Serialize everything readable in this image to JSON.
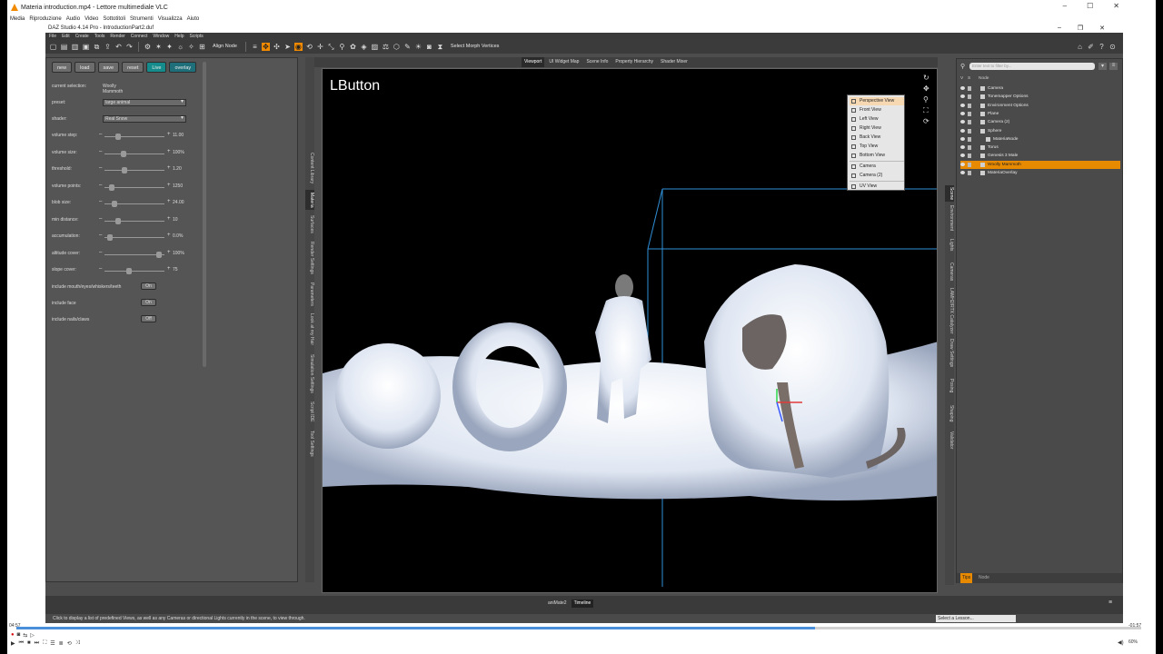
{
  "vlc": {
    "title": "Materia introduction.mp4 - Lettore multimediale VLC",
    "menu": [
      "Media",
      "Riproduzione",
      "Audio",
      "Video",
      "Sottotitoli",
      "Strumenti",
      "Visualizza",
      "Aiuto"
    ],
    "time_elapsed": "04:57",
    "time_total": "-01:57",
    "progress": 0.71,
    "volume": "60%"
  },
  "daz": {
    "title": "DAZ Studio 4.14 Pro - IntroductionPart2.duf",
    "menu": [
      "File",
      "Edit",
      "Create",
      "Tools",
      "Render",
      "Connect",
      "Window",
      "Help",
      "Scripts"
    ],
    "toolbar": {
      "align_node": "Align Node",
      "select_morph": "Select Morph Vertices"
    },
    "status_text": "Click to display a list of predefined Views, as well as any Cameras or directional Lights currently in the scene, to view through.",
    "timeline_tabs": [
      "aniMate2",
      "Timeline"
    ],
    "lesson_select": "Select a Lesson...",
    "tips_tabs": [
      "Tips",
      "Node"
    ]
  },
  "materia": {
    "buttons": [
      "new",
      "load",
      "save",
      "reset",
      "Live",
      "overlay"
    ],
    "current_selection_label": "current selection:",
    "current_selection_value": "Woolly Mammoth",
    "preset_label": "preset:",
    "preset_value": "large animal",
    "shader_label": "shader:",
    "shader_value": "Real Snow",
    "sliders": [
      {
        "label": "volume step:",
        "value": "11.00",
        "pos": 0.2
      },
      {
        "label": "volume size:",
        "value": "100%",
        "pos": 0.3
      },
      {
        "label": "threshold:",
        "value": "1.20",
        "pos": 0.32
      },
      {
        "label": "volume points:",
        "value": "1250",
        "pos": 0.08
      },
      {
        "label": "blob size:",
        "value": "24.00",
        "pos": 0.14
      },
      {
        "label": "min distance:",
        "value": "10",
        "pos": 0.2
      },
      {
        "label": "accumulation:",
        "value": "0.0%",
        "pos": 0.05
      },
      {
        "label": "altitude cover:",
        "value": "100%",
        "pos": 0.95
      },
      {
        "label": "slope cover:",
        "value": "75",
        "pos": 0.4
      }
    ],
    "toggles": [
      {
        "label": "include mouth/eyes/whiskers/teeth",
        "value": "On"
      },
      {
        "label": "include face",
        "value": "On"
      },
      {
        "label": "include nails/claws",
        "value": "Off"
      }
    ]
  },
  "left_tabs": [
    "Content Library",
    "Materia",
    "Surfaces",
    "Render Settings",
    "Parameters",
    "Look at my Hair",
    "Simulation Settings",
    "Script IDE",
    "Tool Settings"
  ],
  "viewport_tabs": [
    "Viewport",
    "UI Widget Map",
    "Scene Info",
    "Property Hierarchy",
    "Shader Mixer"
  ],
  "viewport_label": "LButton",
  "view_menu": [
    "Perspective View",
    "Front View",
    "Left View",
    "Right View",
    "Back View",
    "Top View",
    "Bottom View",
    "Camera",
    "Camera (2)",
    "UV View"
  ],
  "right_tabs": [
    "Scene",
    "Environment",
    "Lights",
    "Cameras",
    "LAMH2/RTX Catalyzer",
    "Draw Settings",
    "Posing",
    "Shaping",
    "Validator"
  ],
  "scene": {
    "search_placeholder": "Enter text to filter by...",
    "header": "Node",
    "nodes": [
      {
        "name": "Camera",
        "indent": 0
      },
      {
        "name": "Tonemapper Options",
        "indent": 0
      },
      {
        "name": "Environment Options",
        "indent": 0
      },
      {
        "name": "Plane",
        "indent": 0
      },
      {
        "name": "Camera (2)",
        "indent": 0
      },
      {
        "name": "Sphere",
        "indent": 0
      },
      {
        "name": "MateriaNode",
        "indent": 1
      },
      {
        "name": "Torus",
        "indent": 0
      },
      {
        "name": "Genesis 3 Male",
        "indent": 0
      },
      {
        "name": "Woolly Mammoth",
        "indent": 0,
        "selected": true
      },
      {
        "name": "MateriaOverlay",
        "indent": 0
      }
    ]
  }
}
